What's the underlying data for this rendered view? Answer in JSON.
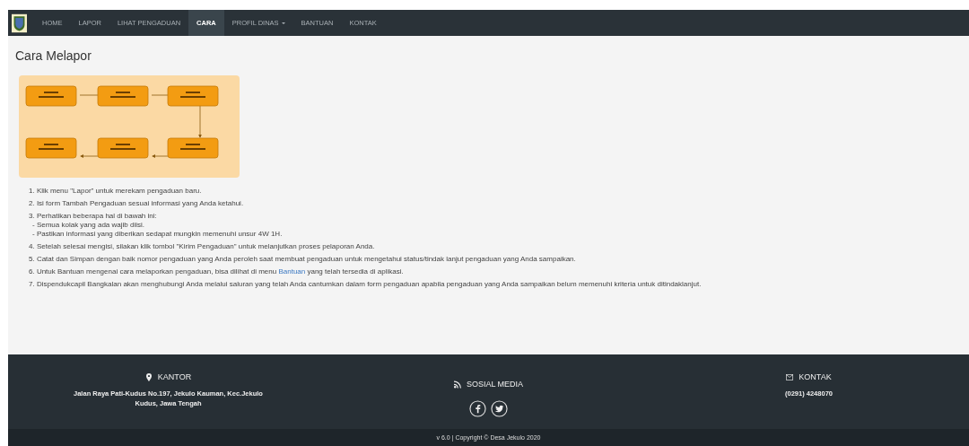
{
  "nav": {
    "items": [
      {
        "label": "HOME",
        "selected": false,
        "dropdown": false
      },
      {
        "label": "LAPOR",
        "selected": false,
        "dropdown": false
      },
      {
        "label": "LIHAT PENGADUAN",
        "selected": false,
        "dropdown": false
      },
      {
        "label": "CARA",
        "selected": true,
        "dropdown": false
      },
      {
        "label": "PROFIL DINAS",
        "selected": false,
        "dropdown": true
      },
      {
        "label": "BANTUAN",
        "selected": false,
        "dropdown": false
      },
      {
        "label": "KONTAK",
        "selected": false,
        "dropdown": false
      }
    ]
  },
  "page": {
    "title": "Cara Melapor",
    "steps": [
      {
        "lines": [
          "1. Klik menu \"Lapor\" untuk merekam pengaduan baru."
        ]
      },
      {
        "lines": [
          "2. Isi form Tambah Pengaduan sesuai informasi yang Anda ketahui."
        ]
      },
      {
        "lines": [
          "3. Perhatikan beberapa hal di bawah ini:",
          "- Semua kolak yang ada wajib diisi.",
          "- Pastikan informasi yang diberikan sedapat mungkin memenuhi unsur 4W 1H."
        ]
      },
      {
        "lines": [
          "4. Setelah selesai mengisi, silakan klik tombol \"Kirim Pengaduan\" untuk melanjutkan proses pelaporan Anda."
        ]
      },
      {
        "lines": [
          "5. Catat dan Simpan dengan baik nomor pengaduan yang Anda peroleh saat membuat pengaduan untuk mengetahui status/tindak lanjut pengaduan yang Anda sampaikan."
        ]
      },
      {
        "lines": [
          "6. Untuk Bantuan mengenai cara melaporkan pengaduan, bisa dilihat di menu"
        ],
        "link": "Bantuan",
        "after": "yang telah tersedia di aplikasi."
      },
      {
        "lines": [
          "7. Dispendukcapil Bangkalan akan menghubungi Anda melalui saluran yang telah Anda cantumkan dalam form pengaduan apabila pengaduan yang Anda sampaikan belum memenuhi kriteria untuk ditindaklanjut."
        ]
      }
    ]
  },
  "footer": {
    "columns": [
      {
        "kind": "address",
        "heading": "KANTOR",
        "lines": [
          "Jalan Raya Pati-Kudus No.197, Jekulo Kauman, Kec.Jekulo",
          "Kudus, Jawa Tengah"
        ]
      },
      {
        "kind": "social",
        "heading": "SOSIAL MEDIA"
      },
      {
        "kind": "contact",
        "heading": "KONTAK",
        "lines": [
          "(0291) 4248070"
        ]
      }
    ],
    "copyright": "v 6.0 | Copyright © Desa Jekulo 2020"
  }
}
